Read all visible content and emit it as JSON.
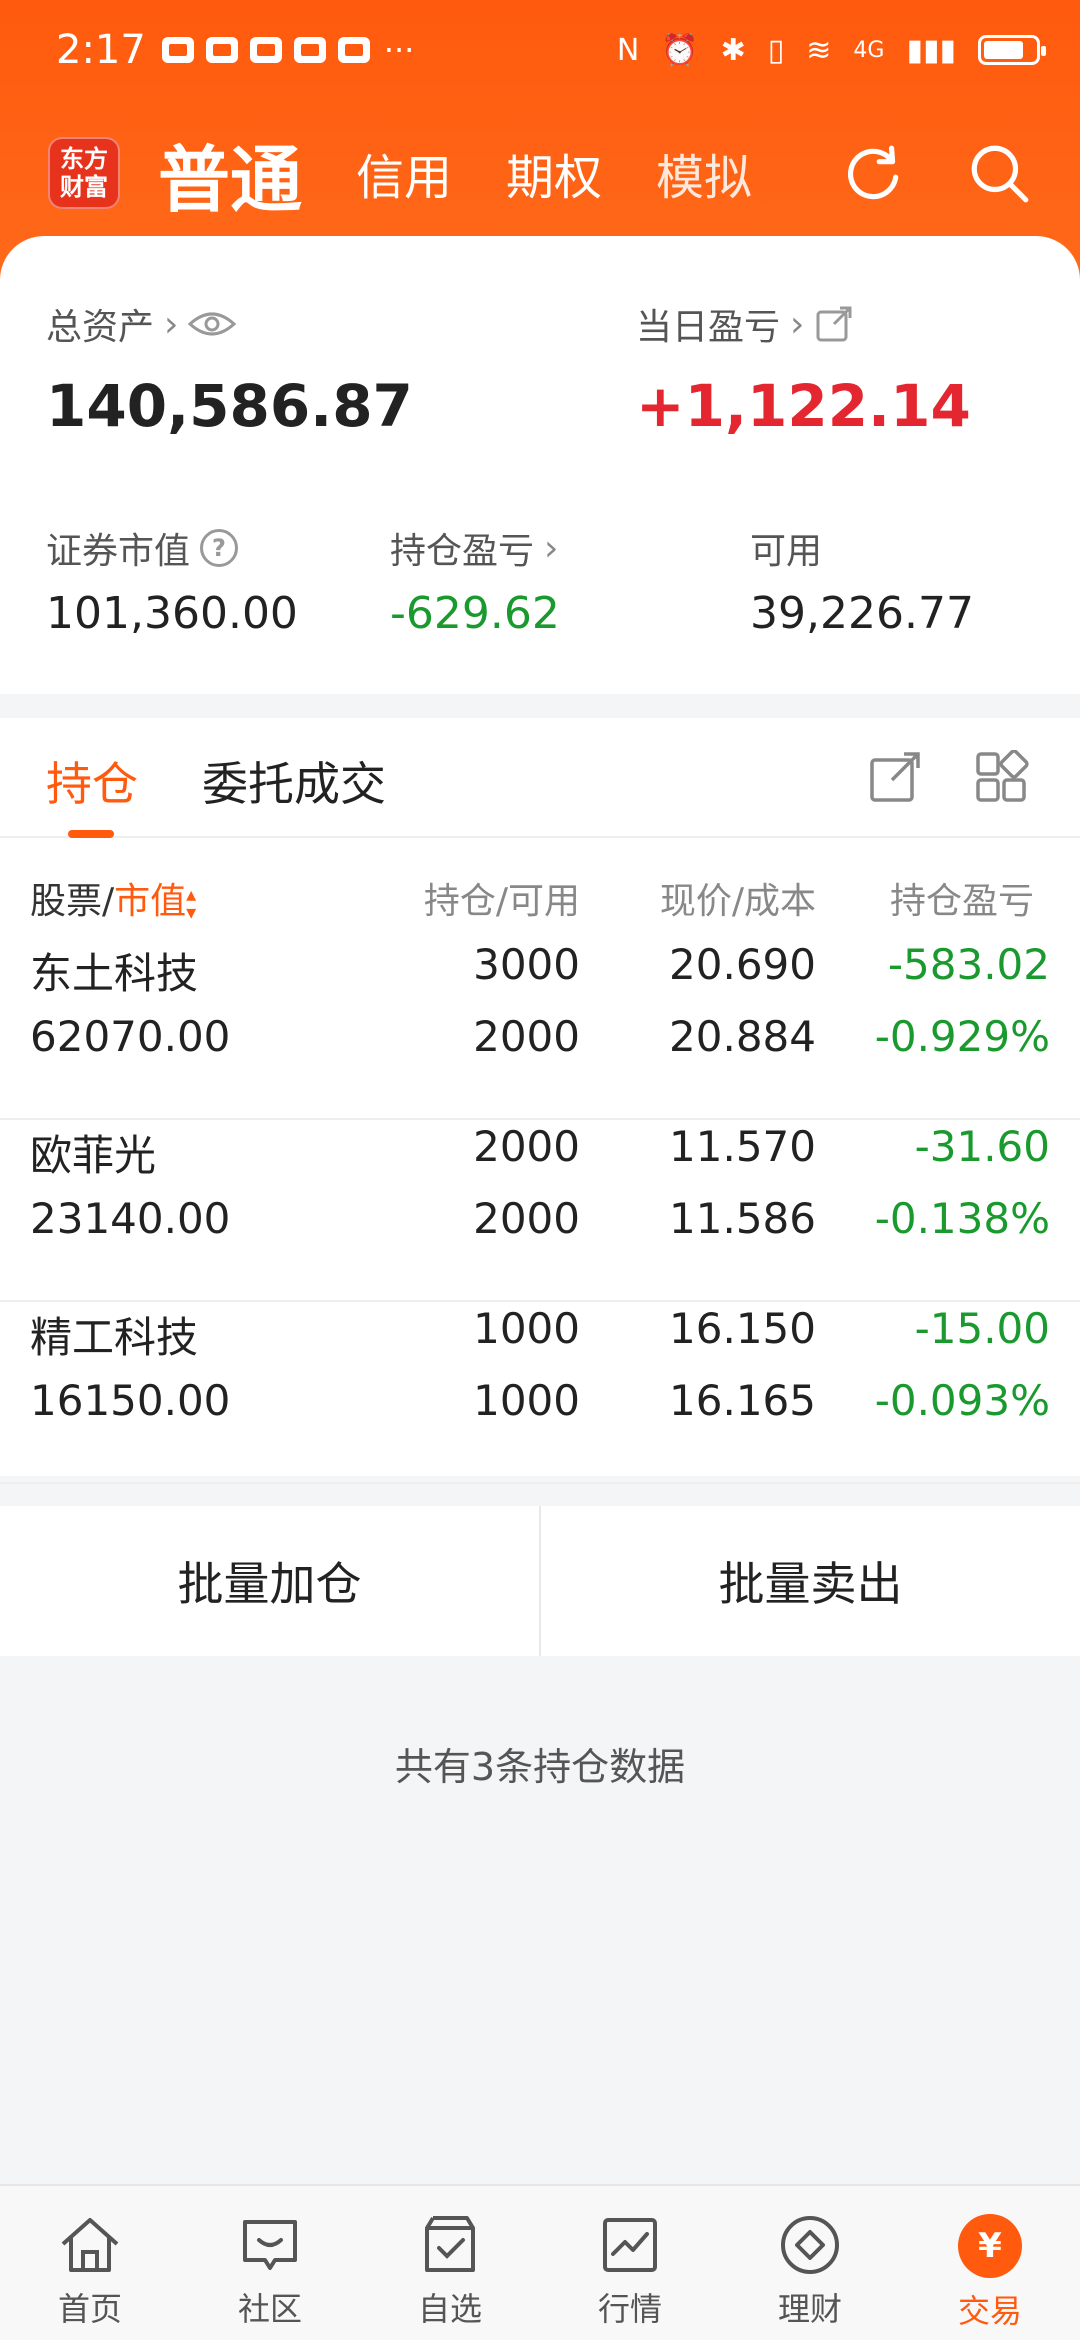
{
  "status": {
    "time": "2:17",
    "more": "···",
    "network": "4G"
  },
  "nav": {
    "logo_line1": "东方",
    "logo_line2": "财富",
    "tabs": [
      "普通",
      "信用",
      "期权",
      "模拟"
    ],
    "active_tab": "普通"
  },
  "assets": {
    "total_label": "总资产",
    "total_value": "140,586.87",
    "daily_pnl_label": "当日盈亏",
    "daily_pnl_value": "+1,122.14",
    "market_value_label": "证券市值",
    "market_value": "101,360.00",
    "position_pnl_label": "持仓盈亏",
    "position_pnl_value": "-629.62",
    "available_label": "可用",
    "available_value": "39,226.77"
  },
  "position_tabs": {
    "holding": "持仓",
    "orders": "委托成交"
  },
  "table": {
    "headers": {
      "stock": "股票/",
      "market_value": "市值",
      "qty": "持仓/可用",
      "price": "现价/成本",
      "pnl": "持仓盈亏"
    },
    "rows": [
      {
        "name": "东土科技",
        "value": "62070.00",
        "hold": "3000",
        "avail": "2000",
        "price": "20.690",
        "cost": "20.884",
        "pnl": "-583.02",
        "pct": "-0.929%"
      },
      {
        "name": "欧菲光",
        "value": "23140.00",
        "hold": "2000",
        "avail": "2000",
        "price": "11.570",
        "cost": "11.586",
        "pnl": "-31.60",
        "pct": "-0.138%"
      },
      {
        "name": "精工科技",
        "value": "16150.00",
        "hold": "1000",
        "avail": "1000",
        "price": "16.150",
        "cost": "16.165",
        "pnl": "-15.00",
        "pct": "-0.093%"
      }
    ]
  },
  "batch": {
    "add": "批量加仓",
    "sell": "批量卖出"
  },
  "summary": "共有3条持仓数据",
  "bottom_nav": [
    {
      "label": "首页",
      "icon": "home-icon"
    },
    {
      "label": "社区",
      "icon": "community-icon"
    },
    {
      "label": "自选",
      "icon": "watchlist-icon"
    },
    {
      "label": "行情",
      "icon": "market-icon"
    },
    {
      "label": "理财",
      "icon": "wealth-icon"
    },
    {
      "label": "交易",
      "icon": "trade-icon",
      "active": true
    }
  ],
  "trade_icon_glyph": "¥",
  "colors": {
    "brand": "#ff5a0e",
    "up": "#e3262f",
    "down": "#1a9a2e"
  }
}
